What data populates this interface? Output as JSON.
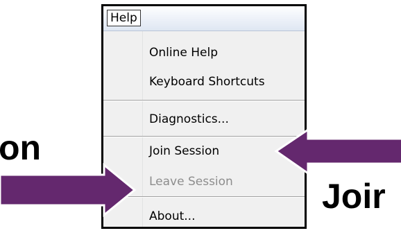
{
  "captions": {
    "left": "on",
    "right": "Joir"
  },
  "colors": {
    "arrow_fill": "#64286e",
    "arrow_stroke": "#ffffff",
    "frame": "#000000",
    "menu_bg": "#f0f0f0",
    "disabled_text": "#8d8d8d"
  },
  "menubar": {
    "help_label": "Help"
  },
  "menu": {
    "items": [
      {
        "label": "Online Help",
        "enabled": true
      },
      {
        "label": "Keyboard Shortcuts",
        "enabled": true
      },
      {
        "label": "Diagnostics...",
        "enabled": true
      },
      {
        "label": "Join Session",
        "enabled": true
      },
      {
        "label": "Leave Session",
        "enabled": false
      },
      {
        "label": "About...",
        "enabled": true
      }
    ]
  },
  "icons": {
    "left_arrow": "arrow-right-icon",
    "right_arrow": "arrow-left-icon"
  }
}
